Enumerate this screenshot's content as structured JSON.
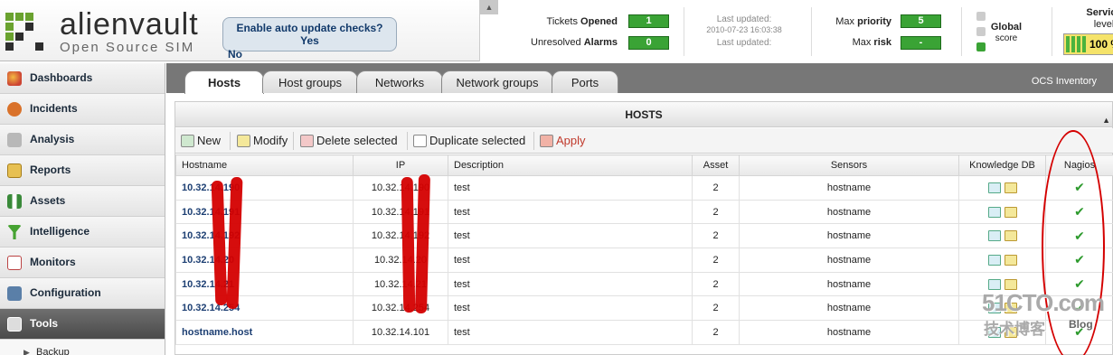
{
  "header": {
    "logo_name": "alienvault",
    "logo_sub": "Open Source SIM",
    "auto_update": {
      "line1": "Enable auto update checks?",
      "yes": "Yes",
      "no": "No"
    },
    "status": {
      "tickets_label": "Tickets",
      "tickets_bold": "Opened",
      "tickets_value": "1",
      "alarms_label": "Unresolved",
      "alarms_bold": "Alarms",
      "alarms_value": "0",
      "last_updated_1": "Last updated:",
      "last_updated_1_value": "2010-07-23 16:03:38",
      "last_updated_2": "Last updated:",
      "priority_label": "Max",
      "priority_bold": "priority",
      "priority_value": "5",
      "risk_label": "Max",
      "risk_bold": "risk",
      "risk_value": "-",
      "global_label": "Global",
      "global_sub": "score",
      "service_label": "Service",
      "service_sub": "level",
      "service_pct": "100 %"
    }
  },
  "sidebar": {
    "items": [
      {
        "label": "Dashboards",
        "icon": "dashboards-icon"
      },
      {
        "label": "Incidents",
        "icon": "incidents-icon"
      },
      {
        "label": "Analysis",
        "icon": "analysis-icon"
      },
      {
        "label": "Reports",
        "icon": "reports-icon"
      },
      {
        "label": "Assets",
        "icon": "assets-icon"
      },
      {
        "label": "Intelligence",
        "icon": "intelligence-icon"
      },
      {
        "label": "Monitors",
        "icon": "monitors-icon"
      },
      {
        "label": "Configuration",
        "icon": "configuration-icon"
      },
      {
        "label": "Tools",
        "icon": "tools-icon"
      }
    ],
    "sub_items": [
      {
        "label": "Backup"
      }
    ]
  },
  "tabs": [
    {
      "label": "Hosts"
    },
    {
      "label": "Host groups"
    },
    {
      "label": "Networks"
    },
    {
      "label": "Network groups"
    },
    {
      "label": "Ports"
    }
  ],
  "ocs_link": "OCS Inventory",
  "panel": {
    "title": "HOSTS"
  },
  "toolbar": {
    "new": "New",
    "modify": "Modify",
    "delete": "Delete selected",
    "duplicate": "Duplicate selected",
    "apply": "Apply"
  },
  "table": {
    "columns": [
      "Hostname",
      "IP",
      "Description",
      "Asset",
      "Sensors",
      "Knowledge DB",
      "Nagios"
    ],
    "rows": [
      {
        "hostname": "10.32.14.190",
        "ip": "10.32.14.190",
        "description": "test",
        "asset": "2",
        "sensors": "hostname",
        "nagios": "✔"
      },
      {
        "hostname": "10.32.14.191",
        "ip": "10.32.14.191",
        "description": "test",
        "asset": "2",
        "sensors": "hostname",
        "nagios": "✔"
      },
      {
        "hostname": "10.32.14.192",
        "ip": "10.32.14.192",
        "description": "test",
        "asset": "2",
        "sensors": "hostname",
        "nagios": "✔"
      },
      {
        "hostname": "10.32.14.20",
        "ip": "10.32.14.20",
        "description": "test",
        "asset": "2",
        "sensors": "hostname",
        "nagios": "✔"
      },
      {
        "hostname": "10.32.14.21",
        "ip": "10.32.14.21",
        "description": "test",
        "asset": "2",
        "sensors": "hostname",
        "nagios": "✔"
      },
      {
        "hostname": "10.32.14.254",
        "ip": "10.32.14.254",
        "description": "test",
        "asset": "2",
        "sensors": "hostname",
        "nagios": "✔"
      },
      {
        "hostname": "hostname.host",
        "ip": "10.32.14.101",
        "description": "test",
        "asset": "2",
        "sensors": "hostname",
        "nagios": "✔"
      }
    ]
  },
  "watermark": {
    "line1": "51CTO.com",
    "line2": "技术博客",
    "line3": "Blog"
  },
  "colors": {
    "accent_green": "#3aa335",
    "brand_green": "#6aa22f",
    "redaction": "#d40000",
    "link_blue": "#1d3f73"
  }
}
